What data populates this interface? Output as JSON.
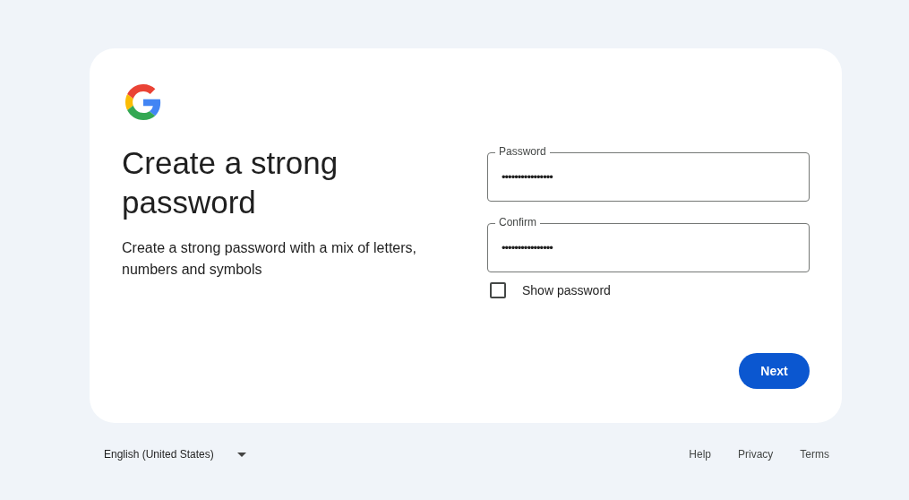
{
  "heading": "Create a strong password",
  "description": "Create a strong password with a mix of letters, numbers and symbols",
  "fields": [
    {
      "label": "Password",
      "value": "••••••••••••••••"
    },
    {
      "label": "Confirm",
      "value": "••••••••••••••••"
    }
  ],
  "show_password": {
    "label": "Show password",
    "checked": false
  },
  "next_button": "Next",
  "footer": {
    "language": "English (United States)",
    "links": [
      "Help",
      "Privacy",
      "Terms"
    ]
  }
}
